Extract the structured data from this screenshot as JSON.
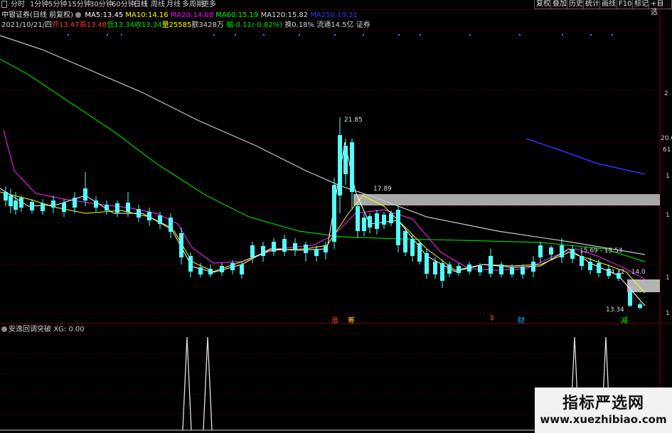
{
  "toolbar": {
    "timeframes": [
      "分时",
      "1分钟",
      "5分钟",
      "15分钟",
      "30分钟",
      "60分钟",
      "日线",
      "周线",
      "月线",
      "多周期",
      "更多"
    ],
    "active": "日线",
    "buttons": [
      "复权",
      "叠加",
      "历史",
      "统计",
      "画线",
      "F10",
      "标记",
      "+自选",
      "返回"
    ]
  },
  "header": {
    "title": "中银证券(日线 前复权)",
    "ma": [
      {
        "label": "MA5:",
        "value": "13.45",
        "color": "#ffffff"
      },
      {
        "label": "MA10:",
        "value": "14.16",
        "color": "#ffff00"
      },
      {
        "label": "MA20:",
        "value": "14.68",
        "color": "#ff00ff"
      },
      {
        "label": "MA60:",
        "value": "15.19",
        "color": "#00ff00"
      },
      {
        "label": "MA120:",
        "value": "15.82",
        "color": "#d8d8d8"
      },
      {
        "label": "MA250:",
        "value": "19.31",
        "color": "#3333ff"
      }
    ],
    "date": "2021/10/21/四",
    "open_label": "开",
    "open": "13.47",
    "high_label": "高",
    "high": "13.48",
    "low_label": "低",
    "low": "13.34",
    "close_label": "收",
    "close": "13.34",
    "vol_label": "量",
    "vol": "25585",
    "amt_label": "额",
    "amt": "3428万",
    "chg_label": "幅",
    "chg": "-0.11(-0.82%)",
    "turn_label": "换",
    "turn": "0.18%",
    "float_label": "流通",
    "float": "14.5亿",
    "sector": "证券"
  },
  "axis": {
    "labels": [
      "2",
      "20.6",
      "61",
      "1",
      "1",
      "1",
      "1"
    ]
  },
  "annotations": {
    "peak": "21.85",
    "level1": "17.89",
    "level2": "15.69 - 15.53",
    "level3": "14.72 - 14.0",
    "low": "13.34",
    "mark_zhang": "涨",
    "mark_chou": "筹",
    "mark_s": "$",
    "mark_cai": "财",
    "mark_jian": "减"
  },
  "indicator": {
    "name": "安逸回调突破",
    "series": "XG:",
    "value": "0.00"
  },
  "watermark": {
    "title": "指标严选网",
    "url": "www.xuezhibiao.com"
  },
  "chart_data": {
    "type": "candlestick",
    "title": "中银证券(日线 前复权)",
    "price_points": {
      "peak": 21.85,
      "resistance": 17.89,
      "zone_mid": [
        15.69,
        15.53
      ],
      "zone_low": [
        14.72,
        14.0
      ],
      "last_low": 13.34
    },
    "ma_last": {
      "MA5": 13.45,
      "MA10": 14.16,
      "MA20": 14.68,
      "MA60": 15.19,
      "MA120": 15.82,
      "MA250": 19.31
    },
    "signal": {
      "name": "安逸回调突破",
      "XG": 0.0,
      "spike_count": 4
    }
  }
}
